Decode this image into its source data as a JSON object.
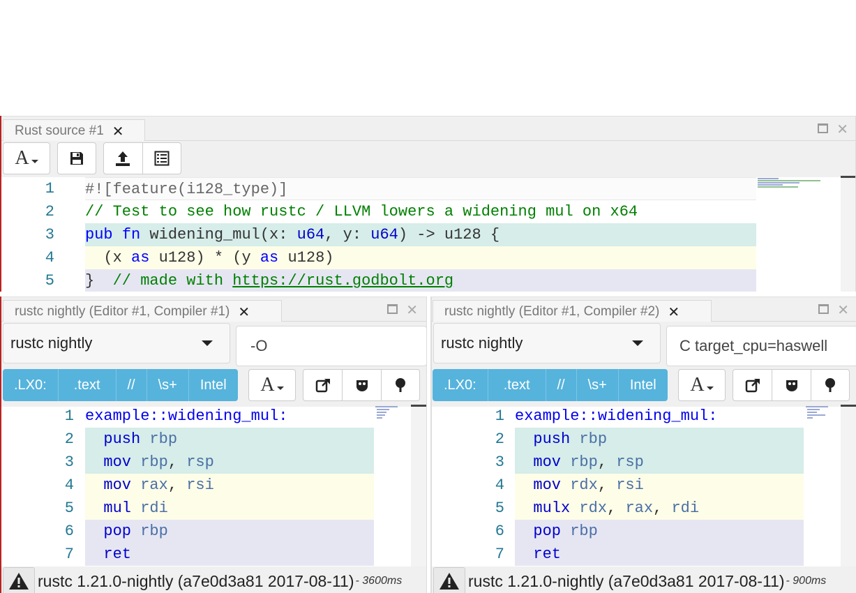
{
  "editor": {
    "tab_title": "Rust source #1",
    "close_glyph": "✕",
    "toolbar": {
      "font_button": "A",
      "save_icon": "save-icon",
      "upload_icon": "upload-icon",
      "list_icon": "list-icon"
    },
    "lines": [
      {
        "num": "1",
        "text": "#![feature(i128_type)]"
      },
      {
        "num": "2",
        "text": "// Test to see how rustc / LLVM lowers a widening mul on x64"
      },
      {
        "num": "3",
        "text": "pub fn widening_mul(x: u64, y: u64) -> u128 {"
      },
      {
        "num": "4",
        "text": "  (x as u128) * (y as u128)"
      },
      {
        "num": "5",
        "text": "}  // made with https://rust.godbolt.org"
      }
    ],
    "tokens": {
      "l1": "#![feature(i128_type)]",
      "l2": "// Test to see how rustc / LLVM lowers a widening mul on x64",
      "l3_pub": "pub",
      "l3_fn": "fn",
      "l3_name": " widening_mul(x: ",
      "l3_u64a": "u64",
      "l3_mid": ", y: ",
      "l3_u64b": "u64",
      "l3_end": ") -> u128 {",
      "l4_a": "  (x ",
      "l4_as1": "as",
      "l4_b": " u128) * (y ",
      "l4_as2": "as",
      "l4_c": " u128)",
      "l5_brace": "}  ",
      "l5_comment": "// made with ",
      "l5_link": "https://rust.godbolt.org"
    }
  },
  "compilers": [
    {
      "tab_title": "rustc nightly (Editor #1, Compiler #1)",
      "compiler_select": "rustc nightly",
      "options": "-O",
      "filters": [
        ".LX0:",
        ".text",
        "//",
        "\\s+",
        "Intel"
      ],
      "asm": [
        {
          "num": "1",
          "label": "example::widening_mul:"
        },
        {
          "num": "2",
          "op": "push",
          "args": [
            [
              "reg",
              "rbp"
            ]
          ]
        },
        {
          "num": "3",
          "op": "mov",
          "args": [
            [
              "reg",
              "rbp"
            ],
            [
              "p",
              ", "
            ],
            [
              "reg",
              "rsp"
            ]
          ]
        },
        {
          "num": "4",
          "op": "mov",
          "args": [
            [
              "reg",
              "rax"
            ],
            [
              "p",
              ", "
            ],
            [
              "reg",
              "rsi"
            ]
          ]
        },
        {
          "num": "5",
          "op": "mul",
          "args": [
            [
              "reg",
              "rdi"
            ]
          ]
        },
        {
          "num": "6",
          "op": "pop",
          "args": [
            [
              "reg",
              "rbp"
            ]
          ]
        },
        {
          "num": "7",
          "op": "ret",
          "args": []
        }
      ],
      "status": {
        "version": "rustc 1.21.0-nightly (a7e0d3a81 2017-08-11)",
        "time": "- 3600ms"
      }
    },
    {
      "tab_title": "rustc nightly (Editor #1, Compiler #2)",
      "compiler_select": "rustc nightly",
      "options": "C target_cpu=haswell",
      "filters": [
        ".LX0:",
        ".text",
        "//",
        "\\s+",
        "Intel"
      ],
      "asm": [
        {
          "num": "1",
          "label": "example::widening_mul:"
        },
        {
          "num": "2",
          "op": "push",
          "args": [
            [
              "reg",
              "rbp"
            ]
          ]
        },
        {
          "num": "3",
          "op": "mov",
          "args": [
            [
              "reg",
              "rbp"
            ],
            [
              "p",
              ", "
            ],
            [
              "reg",
              "rsp"
            ]
          ]
        },
        {
          "num": "4",
          "op": "mov",
          "args": [
            [
              "reg",
              "rdx"
            ],
            [
              "p",
              ", "
            ],
            [
              "reg",
              "rsi"
            ]
          ]
        },
        {
          "num": "5",
          "op": "mulx",
          "args": [
            [
              "reg",
              "rdx"
            ],
            [
              "p",
              ", "
            ],
            [
              "reg",
              "rax"
            ],
            [
              "p",
              ", "
            ],
            [
              "reg",
              "rdi"
            ]
          ]
        },
        {
          "num": "6",
          "op": "pop",
          "args": [
            [
              "reg",
              "rbp"
            ]
          ]
        },
        {
          "num": "7",
          "op": "ret",
          "args": []
        }
      ],
      "status": {
        "version": "rustc 1.21.0-nightly (a7e0d3a81 2017-08-11)",
        "time": "- 900ms"
      }
    }
  ],
  "colors": {
    "filter_bar": "#56b3dc",
    "line_bg_a": "#d6ede9",
    "line_bg_b": "#fefde8",
    "line_bg_c": "#e6e6f3",
    "line_number": "#237893",
    "instruction": "#0000cc",
    "register": "#4a6fa5",
    "comment": "#008000"
  }
}
